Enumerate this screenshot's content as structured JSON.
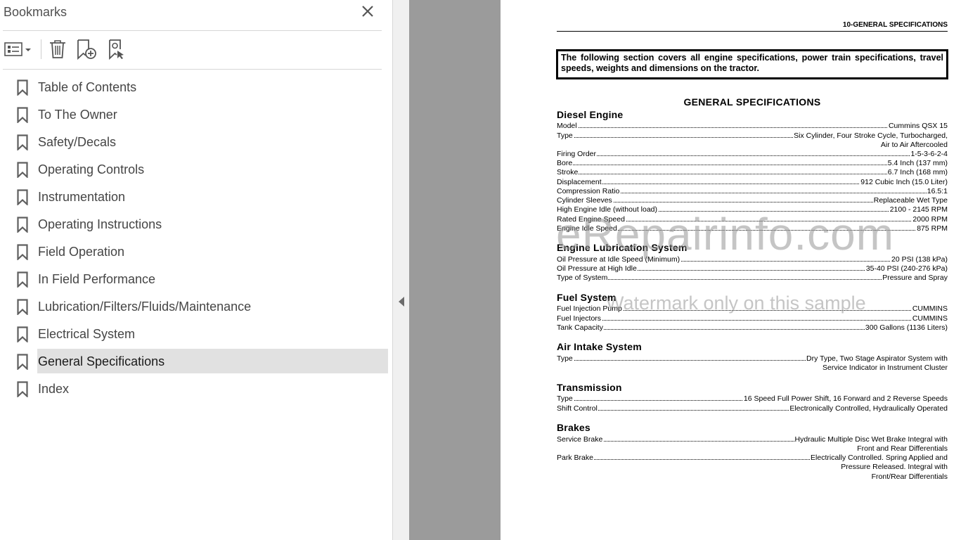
{
  "bookmarks_panel": {
    "title": "Bookmarks",
    "toolbar": {
      "options_icon": "list-options-icon",
      "delete_icon": "trash-icon",
      "add_icon": "add-bookmark-icon",
      "find_icon": "find-bookmark-icon"
    },
    "items": [
      {
        "label": "Table of Contents"
      },
      {
        "label": "To The Owner"
      },
      {
        "label": "Safety/Decals"
      },
      {
        "label": "Operating Controls"
      },
      {
        "label": "Instrumentation"
      },
      {
        "label": "Operating Instructions"
      },
      {
        "label": "Field Operation"
      },
      {
        "label": "In Field Performance"
      },
      {
        "label": "Lubrication/Filters/Fluids/Maintenance"
      },
      {
        "label": "Electrical System"
      },
      {
        "label": "General Specifications",
        "selected": true
      },
      {
        "label": "Index"
      }
    ]
  },
  "document": {
    "header": "10-GENERAL SPECIFICATIONS",
    "intro": "The following section covers all engine specifications, power train specifications, travel speeds, weights and dimensions on the tractor.",
    "title": "GENERAL SPECIFICATIONS",
    "sections": {
      "diesel": {
        "title": "Diesel Engine",
        "rows": [
          {
            "k": "Model",
            "v": "Cummins QSX 15"
          },
          {
            "k": "Type",
            "v": "Six Cylinder, Four Stroke Cycle, Turbocharged,",
            "cont": "Air to Air Aftercooled"
          },
          {
            "k": "Firing Order",
            "v": "1-5-3-6-2-4"
          },
          {
            "k": "Bore",
            "v": "5.4 Inch (137 mm)"
          },
          {
            "k": "Stroke",
            "v": "6.7 Inch (168 mm)"
          },
          {
            "k": "Displacement",
            "v": "912 Cubic Inch (15.0 Liter)"
          },
          {
            "k": "Compression Ratio",
            "v": "16.5:1"
          },
          {
            "k": "Cylinder Sleeves",
            "v": "Replaceable Wet Type"
          },
          {
            "k": "High Engine Idle (without load)",
            "v": "2100 - 2145 RPM"
          },
          {
            "k": "Rated Engine Speed",
            "v": "2000 RPM"
          },
          {
            "k": "Engine Idle Speed",
            "v": "875 RPM"
          }
        ]
      },
      "lube": {
        "title": "Engine Lubrication System",
        "rows": [
          {
            "k": "Oil Pressure at Idle Speed (Minimum)",
            "v": "20 PSI (138 kPa)"
          },
          {
            "k": "Oil Pressure at High Idle",
            "v": "35-40 PSI (240-276 kPa)"
          },
          {
            "k": "Type of System",
            "v": "Pressure and Spray"
          }
        ]
      },
      "fuel": {
        "title": "Fuel System",
        "rows": [
          {
            "k": "Fuel Injection Pump",
            "v": "CUMMINS"
          },
          {
            "k": "Fuel Injectors",
            "v": "CUMMINS"
          },
          {
            "k": "Tank Capacity",
            "v": "300 Gallons (1136 Liters)"
          }
        ]
      },
      "air": {
        "title": "Air Intake System",
        "rows": [
          {
            "k": "Type",
            "v": "Dry Type, Two Stage Aspirator System with",
            "cont": "Service Indicator in Instrument Cluster"
          }
        ]
      },
      "trans": {
        "title": "Transmission",
        "rows": [
          {
            "k": "Type",
            "v": "16 Speed Full Power Shift, 16 Forward and 2 Reverse Speeds"
          },
          {
            "k": "Shift Control",
            "v": "Electronically Controlled, Hydraulically Operated"
          }
        ]
      },
      "brakes": {
        "title": "Brakes",
        "rows": [
          {
            "k": "Service Brake",
            "v": "Hydraulic Multiple Disc Wet Brake Integral with",
            "cont": "Front and Rear Differentials"
          },
          {
            "k": "Park Brake",
            "v": "Electrically Controlled. Spring Applied and",
            "cont": "Pressure Released. Integral with",
            "cont2": "Front/Rear Differentials"
          }
        ]
      }
    },
    "watermark_large": "eRepairinfo.com",
    "watermark_small": "Watermark only on this sample"
  }
}
